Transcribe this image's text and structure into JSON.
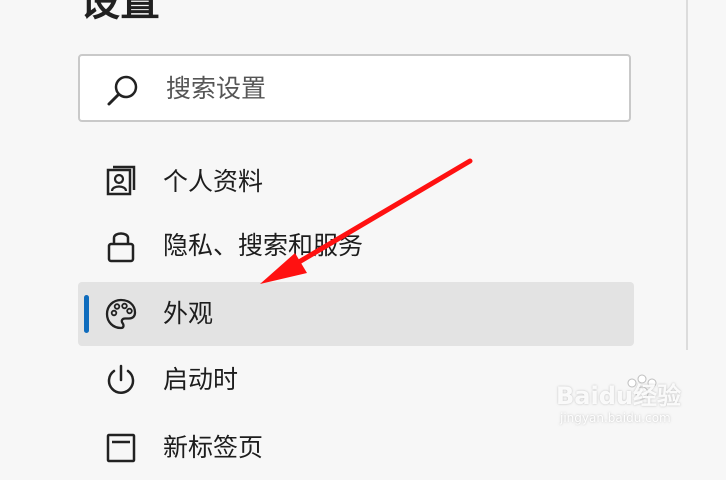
{
  "page": {
    "title": "设置"
  },
  "search": {
    "placeholder": "搜索设置",
    "icon": "search-icon"
  },
  "nav": {
    "items": [
      {
        "label": "个人资料",
        "icon": "profile-icon",
        "selected": false
      },
      {
        "label": "隐私、搜索和服务",
        "icon": "lock-icon",
        "selected": false
      },
      {
        "label": "外观",
        "icon": "palette-icon",
        "selected": true
      },
      {
        "label": "启动时",
        "icon": "power-icon",
        "selected": false
      },
      {
        "label": "新标签页",
        "icon": "new-tab-icon",
        "selected": false
      }
    ]
  },
  "colors": {
    "accent": "#0f6cbd",
    "selected_background": "#e3e3e3",
    "annotation_arrow": "#ff1111"
  },
  "watermark": {
    "brand": "Baidu经验",
    "domain": "jingyan.baidu.com"
  }
}
